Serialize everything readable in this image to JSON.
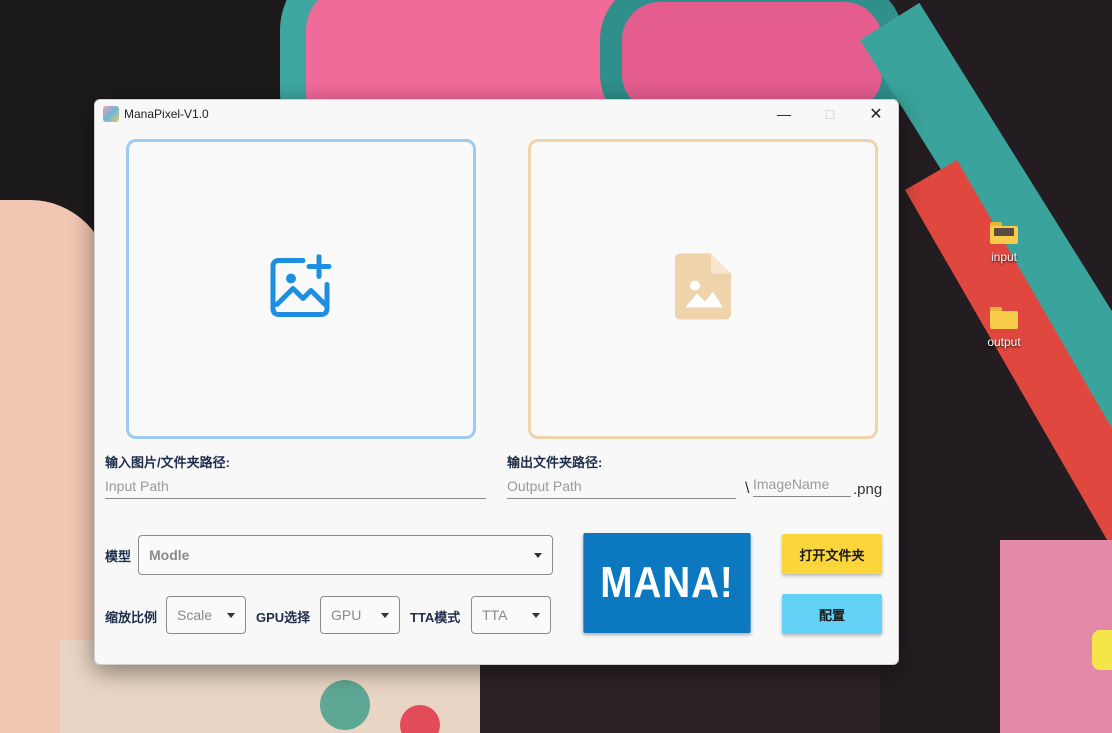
{
  "desktop": {
    "icons": [
      {
        "label": "input"
      },
      {
        "label": "output"
      }
    ]
  },
  "window": {
    "title": "ManaPixel-V1.0",
    "controls": {
      "minimize": "—",
      "maximize": "□",
      "close": "✕"
    }
  },
  "input_area": {
    "label": "输入图片/文件夹路径:",
    "placeholder": "Input Path",
    "icon": "add-image-icon",
    "border_color": "#9dcaf0"
  },
  "output_area": {
    "label": "输出文件夹路径:",
    "placeholder": "Output Path",
    "separator": "\\",
    "name_placeholder": "ImageName",
    "extension": ".png",
    "icon": "image-file-icon",
    "border_color": "#efd3aa"
  },
  "model": {
    "label": "模型",
    "value": "Modle"
  },
  "scale": {
    "label": "缩放比例",
    "value": "Scale"
  },
  "gpu": {
    "label": "GPU选择",
    "value": "GPU"
  },
  "tta": {
    "label": "TTA模式",
    "value": "TTA"
  },
  "buttons": {
    "mana": "MANA!",
    "open_folder": "打开文件夹",
    "config": "配置"
  },
  "colors": {
    "mana_button": "#0b78bf",
    "open_button": "#fbd63b",
    "config_button": "#62d2f7",
    "label_text": "#1e2e4a"
  }
}
